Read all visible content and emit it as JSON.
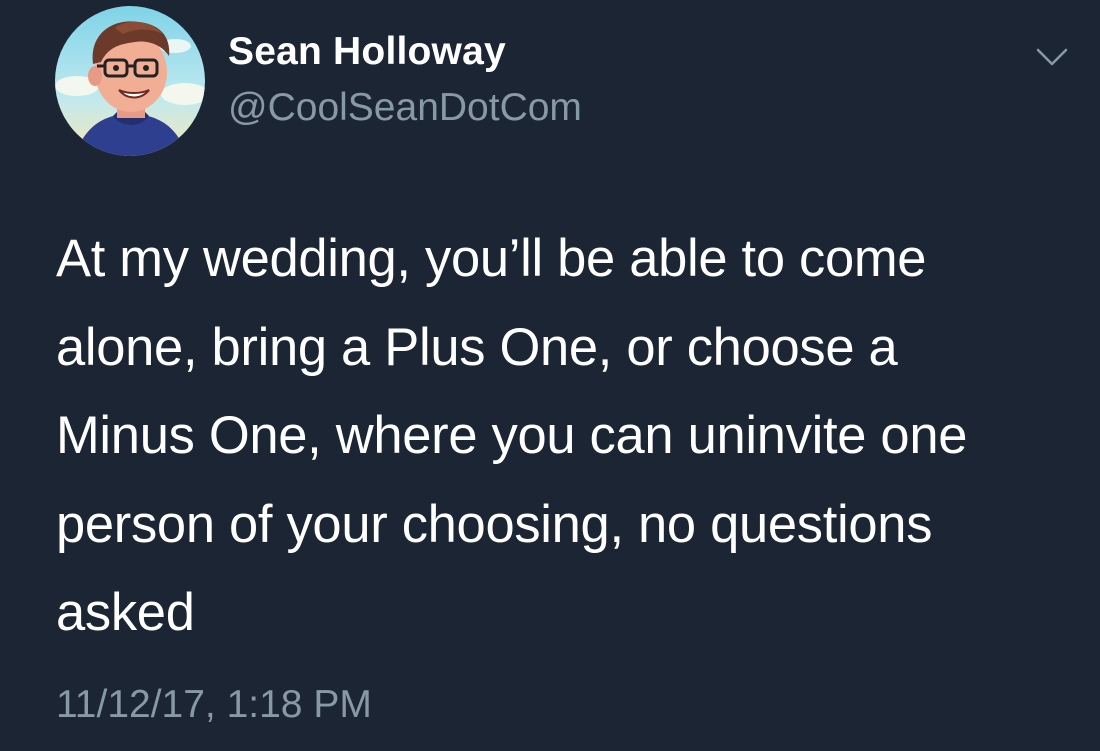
{
  "user": {
    "display_name": "Sean Holloway",
    "handle": "@CoolSeanDotCom",
    "avatar_icon": "cartoon-portrait-avatar"
  },
  "menu": {
    "icon": "chevron-down-icon"
  },
  "tweet": {
    "lines": [
      "At my wedding, you’ll be able to come",
      "alone, bring a Plus One, or choose a",
      "Minus One, where you can uninvite one",
      "person of your choosing, no questions",
      "asked"
    ],
    "timestamp": "11/12/17, 1:18 PM"
  },
  "colors": {
    "background": "#1c2533",
    "primary_text": "#ffffff",
    "secondary_text": "#8899a6"
  }
}
